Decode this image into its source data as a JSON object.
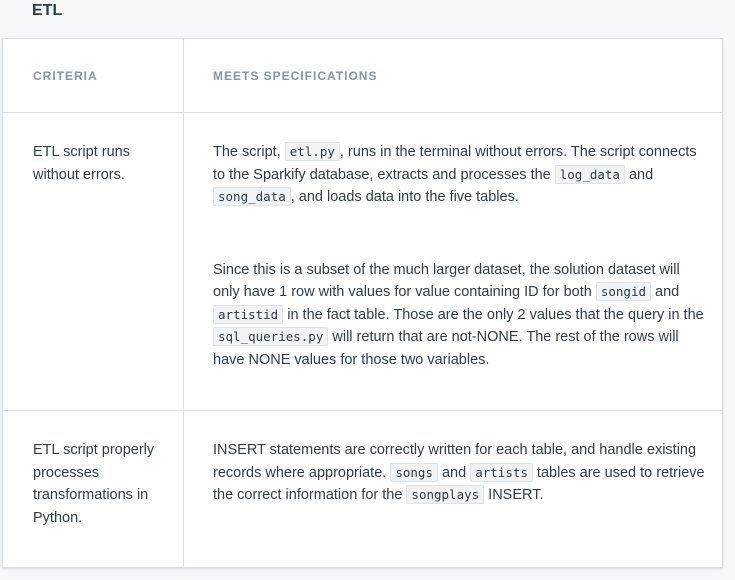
{
  "section": {
    "title": "ETL"
  },
  "table": {
    "header": {
      "criteria": "CRITERIA",
      "specs": "MEETS SPECIFICATIONS"
    },
    "rows": [
      {
        "criteria": "ETL script runs without errors.",
        "p1": {
          "t1": "The script, ",
          "c1": "etl.py",
          "t2": ", runs in the terminal without errors. The script connects to the Sparkify database, extracts and processes the ",
          "c2": "log_data",
          "t3": " and ",
          "c3": "song_data",
          "t4": ", and loads data into the five tables."
        },
        "p2": {
          "t1": "Since this is a subset of the much larger dataset, the solution dataset will only have 1 row with values for value containing ID for both ",
          "c1": "songid",
          "t2": " and ",
          "c2": "artistid",
          "t3": " in the fact table. Those are the only 2 values that the query in the ",
          "c3": "sql_queries.py",
          "t4": " will return that are not-NONE. The rest of the rows will have NONE values for those two variables."
        }
      },
      {
        "criteria": "ETL script properly processes transformations in Python.",
        "p1": {
          "t1": "INSERT statements are correctly written for each table, and handle existing records where appropriate. ",
          "c1": "songs",
          "t2": " and ",
          "c2": "artists",
          "t3": " tables are used to retrieve the correct information for the ",
          "c3": "songplays",
          "t4": " INSERT."
        }
      }
    ]
  }
}
